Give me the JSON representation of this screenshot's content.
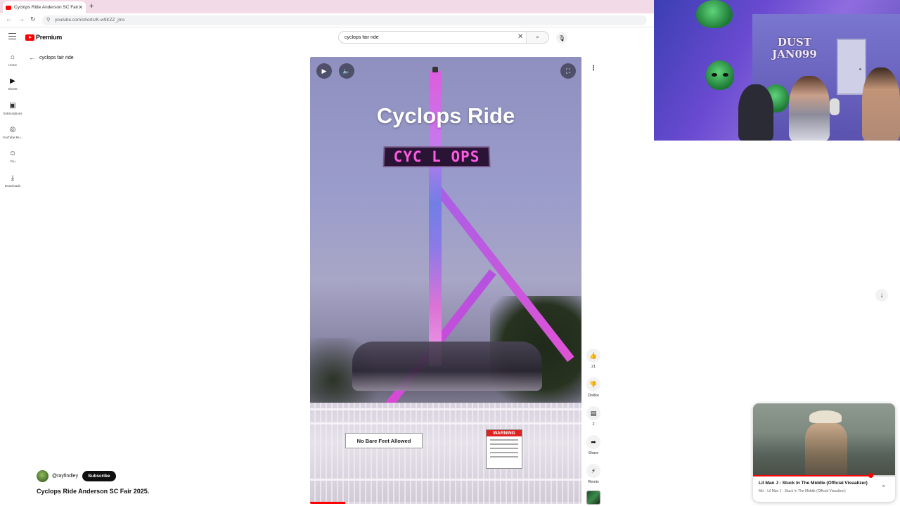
{
  "browser": {
    "tab_title": "Cyclops Ride Anderson SC Fair",
    "url": "youtube.com/shorts/K-w9KZZ_jms",
    "tab_close": "✕",
    "new_tab": "+"
  },
  "header": {
    "logo_text": "Premium",
    "search_value": "cyclops fair ride"
  },
  "sidebar": {
    "items": [
      {
        "icon": "home-icon",
        "label": "Home"
      },
      {
        "icon": "shorts-icon",
        "label": "Shorts"
      },
      {
        "icon": "subscriptions-icon",
        "label": "Subscriptions"
      },
      {
        "icon": "youtube-music-icon",
        "label": "YouTube Mu..."
      },
      {
        "icon": "you-icon",
        "label": "You"
      },
      {
        "icon": "downloads-icon",
        "label": "Downloads"
      }
    ]
  },
  "back_link": "cyclops fair ride",
  "video": {
    "overlay_title": "Cyclops Ride",
    "sign_text": "CYC L OPS",
    "sign_bare_feet": "No Bare Feet Allowed",
    "sign_warning": "WARNING",
    "progress": 0.13
  },
  "actions": {
    "like_count": "21",
    "dislike_label": "Dislike",
    "comment_count": "2",
    "share_label": "Share",
    "remix_label": "Remix"
  },
  "channel": {
    "handle": "@rayfindley",
    "subscribe_label": "Subscribe",
    "video_title": "Cyclops Ride Anderson SC Fair 2025."
  },
  "webcam": {
    "sign_text_line1": "DUST",
    "sign_text_line2": "JAN099"
  },
  "mini_player": {
    "title": "Lil Man J - Stuck In The Middle (Official Visualizer)",
    "subtitle": "Mix - Lil Man J - Stuck In The Middle (Official Visualizer)",
    "progress": 0.83
  },
  "colors": {
    "brand_red": "#ff0000",
    "subscribe_bg": "#0f0f0f"
  }
}
